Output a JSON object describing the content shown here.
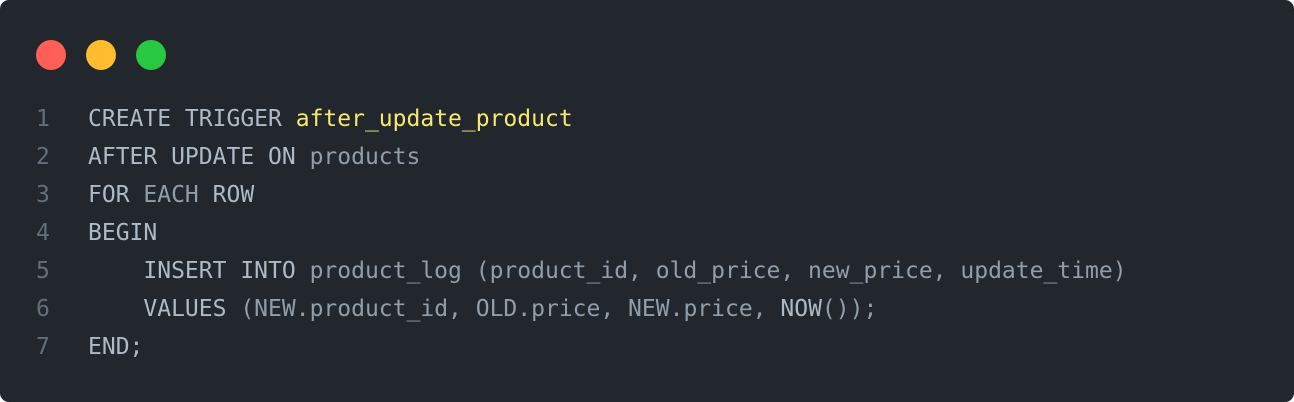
{
  "window_controls": {
    "close_color": "#ff5f57",
    "minimize_color": "#febc2e",
    "maximize_color": "#28c840"
  },
  "theme": {
    "keyword": "#adbac7",
    "identifier": "#909dab",
    "highlight": "#f7e96f",
    "line_number": "#636e7b",
    "background": "#22272e"
  },
  "code": {
    "lines": [
      {
        "number": "1",
        "tokens": [
          {
            "text": "CREATE TRIGGER ",
            "kind": "keyword"
          },
          {
            "text": "after_update_product",
            "kind": "highlight"
          }
        ]
      },
      {
        "number": "2",
        "tokens": [
          {
            "text": "AFTER UPDATE ON ",
            "kind": "keyword"
          },
          {
            "text": "products",
            "kind": "identifier"
          }
        ]
      },
      {
        "number": "3",
        "tokens": [
          {
            "text": "FOR ",
            "kind": "keyword"
          },
          {
            "text": "EACH ",
            "kind": "identifier"
          },
          {
            "text": "ROW",
            "kind": "keyword"
          }
        ]
      },
      {
        "number": "4",
        "tokens": [
          {
            "text": "BEGIN",
            "kind": "keyword"
          }
        ]
      },
      {
        "number": "5",
        "tokens": [
          {
            "text": "    INSERT INTO ",
            "kind": "keyword"
          },
          {
            "text": "product_log (product_id, old_price, new_price, update_time)",
            "kind": "identifier"
          }
        ]
      },
      {
        "number": "6",
        "tokens": [
          {
            "text": "    VALUES ",
            "kind": "keyword"
          },
          {
            "text": "(NEW.product_id, OLD.price, NEW.price, ",
            "kind": "identifier"
          },
          {
            "text": "NOW",
            "kind": "keyword"
          },
          {
            "text": "());",
            "kind": "identifier"
          }
        ]
      },
      {
        "number": "7",
        "tokens": [
          {
            "text": "END;",
            "kind": "keyword"
          }
        ]
      }
    ]
  }
}
